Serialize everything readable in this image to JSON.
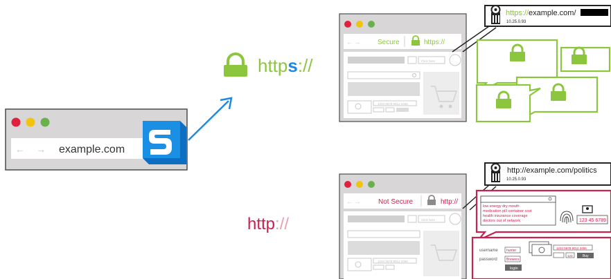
{
  "colors": {
    "secure_green": "#8cc63f",
    "insecure_red": "#c8234f",
    "arrow_blue": "#1e88e5",
    "logo_blue": "#1a8fe3",
    "window_gray": "#d8d6d6",
    "dot_red": "#e0203c",
    "dot_yellow": "#f1c40f",
    "dot_green": "#6ab04c"
  },
  "icons": {
    "padlock": "padlock-icon",
    "logo": "s-logo-icon",
    "secure_page_icon": "building-icon",
    "fingerprint": "fingerprint-icon",
    "id_card": "id-card-icon",
    "credit_card": "credit-card-icon",
    "cash": "cash-icon",
    "cart": "shopping-cart-icon"
  },
  "left_browser": {
    "url": "example.com",
    "back_arrow": "←",
    "forward_arrow": "→"
  },
  "https_label": {
    "prefix": "http",
    "s": "s",
    "suffix": "://"
  },
  "http_label": {
    "prefix": "http",
    "suffix": "://"
  },
  "secure_browser": {
    "status": "Secure",
    "protocol": "https://",
    "popup_url_prefix": "https://",
    "popup_url_rest": "example.com/",
    "popup_ip": "10.25.0.93",
    "mock_button": "Click here",
    "mock_card": "1234 5678 9012 3456"
  },
  "insecure_browser": {
    "status": "Not Secure",
    "protocol": "http://",
    "popup_url": "http://example.com/politics",
    "popup_ip": "10.25.0.93",
    "mock_button": "Click here",
    "mock_card": "1234 5678 9012 3456"
  },
  "leaked": {
    "search_lines": [
      "low energy dry mouth",
      "medication pill container cost",
      "health insurance coverage",
      "doctors out of network"
    ],
    "id_number": "123 45 6789",
    "username_label": "username",
    "username_value": "hunter",
    "password_label": "password",
    "password_value": "Brewers",
    "login_label": "login",
    "card_number": "1234 5678 9012 3456",
    "card_cvv": "123",
    "buy_label": "Buy"
  }
}
